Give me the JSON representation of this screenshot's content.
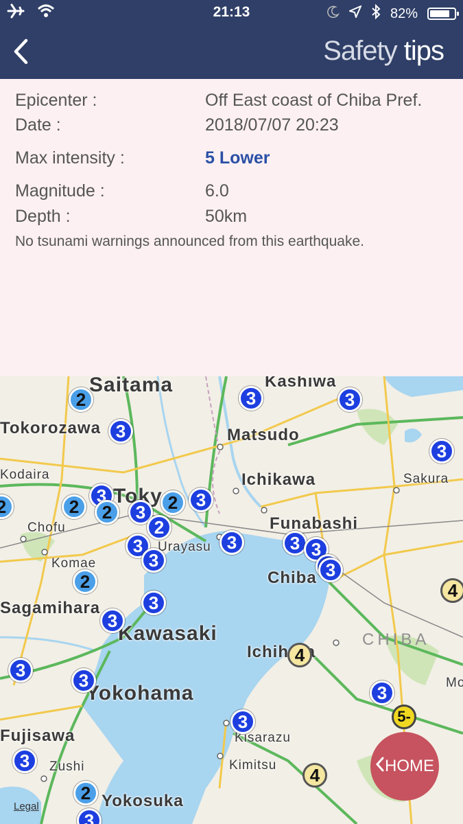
{
  "status_bar": {
    "time": "21:13",
    "battery": "82%",
    "battery_level": 0.82,
    "icons": [
      "airplane-icon",
      "wifi-icon",
      "moon-icon",
      "location-arrow-icon",
      "bluetooth-icon",
      "battery-icon"
    ]
  },
  "nav": {
    "back_icon": "chevron-left-icon",
    "title_light": "Safety",
    "title_bold": "tips"
  },
  "info": {
    "epicenter_label": "Epicenter :",
    "epicenter_value": "Off East coast of Chiba Pref.",
    "date_label": "Date :",
    "date_value": "2018/07/07 20:23",
    "intensity_label": "Max intensity :",
    "intensity_value": "5 Lower",
    "magnitude_label": "Magnitude :",
    "magnitude_value": "6.0",
    "depth_label": "Depth :",
    "depth_value": "50km",
    "tsunami_note": "No tsunami warnings announced from this earthquake."
  },
  "map": {
    "cities": [
      "Saitama",
      "Kashiwa",
      "Tokorozawa",
      "Matsudo",
      "Kodaira",
      "Ichikawa",
      "Sakura",
      "Tokyo",
      "Chofu",
      "Funabashi",
      "Urayasu",
      "Komae",
      "Chiba",
      "Sagamihara",
      "Kawasaki",
      "Ichihara",
      "CHIBA",
      "Yokohama",
      "Kisarazu",
      "Fujisawa",
      "Zushi",
      "Kimitsu",
      "Yokosuka",
      "Mobara"
    ],
    "markers": [
      "2",
      "3",
      "3",
      "3",
      "2",
      "3",
      "3",
      "2",
      "2",
      "2",
      "3",
      "3",
      "2",
      "3",
      "3",
      "3",
      "3",
      "3",
      "3",
      "3",
      "3",
      "2",
      "3",
      "4",
      "3",
      "4",
      "3",
      "3",
      "5-",
      "3",
      "3",
      "4",
      "2",
      "3"
    ],
    "legal": "Legal",
    "colors": {
      "intensity_3": "#1d3fe0",
      "intensity_2": "#4a9fe8",
      "intensity_4": "#f5e6a0",
      "intensity_5_lower": "#f0d820",
      "water": "#a8d5f0"
    }
  },
  "home_button": {
    "icon": "chevron-left-icon",
    "label": "HOME"
  }
}
